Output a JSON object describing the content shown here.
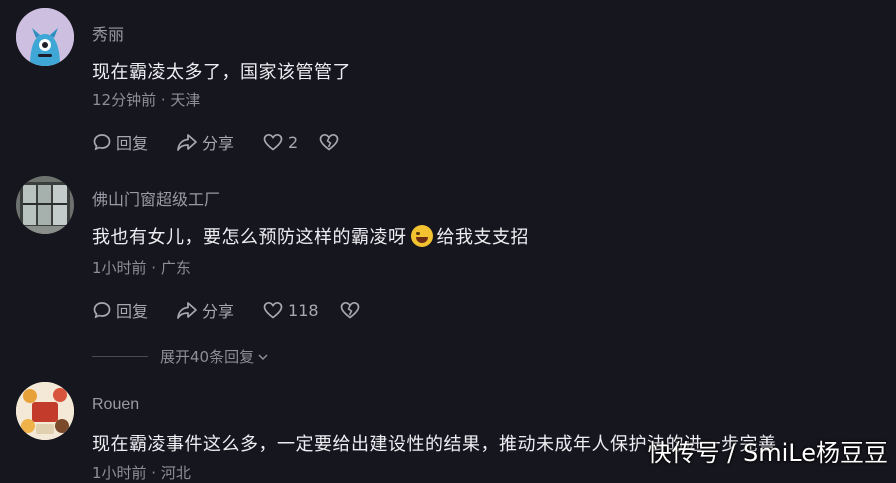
{
  "comments": [
    {
      "username": "秀丽",
      "text": "现在霸凌太多了，国家该管管了",
      "meta": "12分钟前 · 天津",
      "reply_label": "回复",
      "share_label": "分享",
      "like_count": "2"
    },
    {
      "username": "佛山门窗超级工厂",
      "text_before_emoji": "我也有女儿，要怎么预防这样的霸凌呀",
      "text_after_emoji": "给我支支招",
      "meta": "1小时前 · 广东",
      "reply_label": "回复",
      "share_label": "分享",
      "like_count": "118"
    },
    {
      "username": "Rouen",
      "text": "现在霸凌事件这么多，一定要给出建设性的结果，推动未成年人保护法的进一步完善",
      "meta": "1小时前 · 河北"
    }
  ],
  "expand_replies_label": "展开40条回复",
  "watermark": "快传号 / SmiLe杨豆豆",
  "icons": {
    "reply": "comment-bubble-icon",
    "share": "share-arrow-icon",
    "like": "heart-icon",
    "dislike": "broken-heart-icon",
    "expand": "chevron-down-icon"
  }
}
